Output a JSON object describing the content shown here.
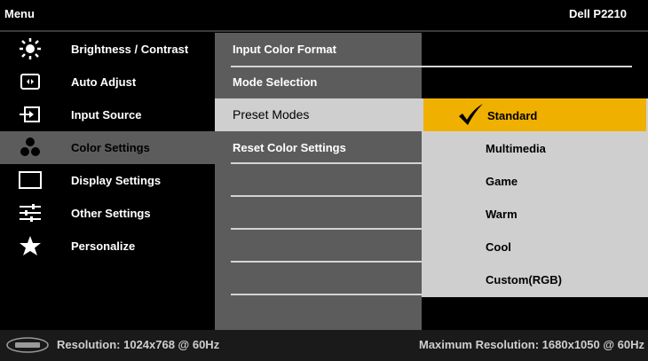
{
  "header": {
    "menu_title": "Menu",
    "model": "Dell P2210"
  },
  "sidebar": {
    "items": [
      {
        "label": "Brightness / Contrast",
        "icon": "brightness-icon"
      },
      {
        "label": "Auto Adjust",
        "icon": "auto-adjust-icon"
      },
      {
        "label": "Input Source",
        "icon": "input-source-icon"
      },
      {
        "label": "Color Settings",
        "icon": "color-settings-icon",
        "selected": true
      },
      {
        "label": "Display Settings",
        "icon": "display-settings-icon"
      },
      {
        "label": "Other Settings",
        "icon": "other-settings-icon"
      },
      {
        "label": "Personalize",
        "icon": "star-icon"
      }
    ]
  },
  "submenu": {
    "items": [
      {
        "label": "Input Color Format"
      },
      {
        "label": "Mode Selection"
      },
      {
        "label": "Preset Modes",
        "active": true
      },
      {
        "label": "Reset Color Settings"
      }
    ]
  },
  "preset_options": {
    "items": [
      {
        "label": "Standard",
        "selected": true
      },
      {
        "label": "Multimedia"
      },
      {
        "label": "Game"
      },
      {
        "label": "Warm"
      },
      {
        "label": "Cool"
      },
      {
        "label": "Custom(RGB)"
      }
    ]
  },
  "footer": {
    "logo_icon": "dell-logo-icon",
    "resolution": "Resolution: 1024x768 @ 60Hz",
    "max_resolution": "Maximum Resolution: 1680x1050 @ 60Hz"
  },
  "colors": {
    "selected_option": "#f0b000",
    "submenu_bg": "#5c5c5c",
    "options_bg": "#cfcfcf"
  }
}
